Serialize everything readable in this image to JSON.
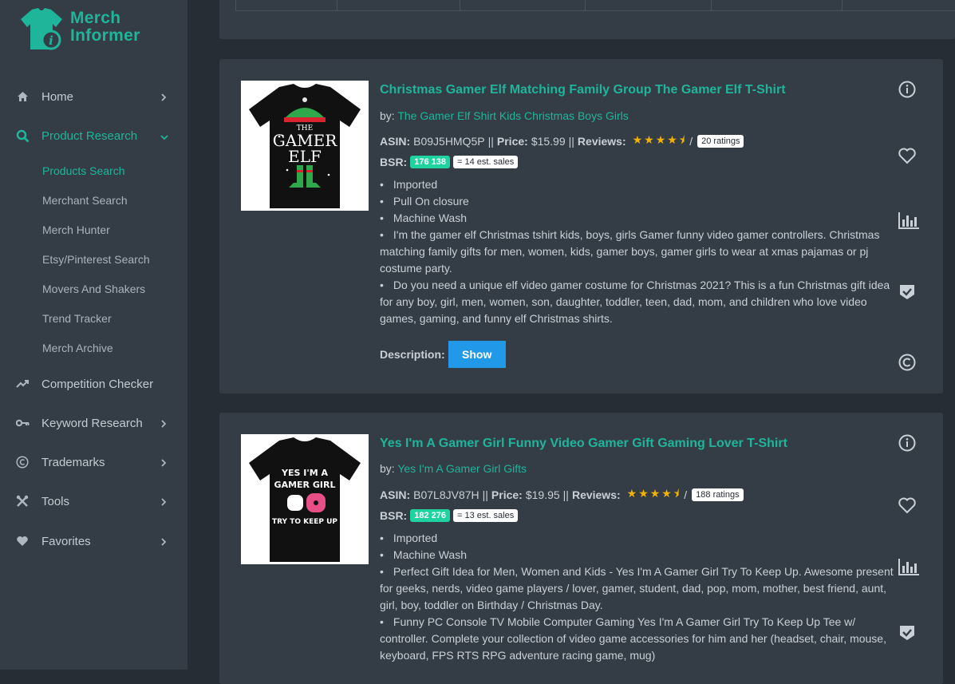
{
  "brand": {
    "line1": "Merch",
    "line2": "Informer",
    "color": "#1fb59b"
  },
  "sidebar": {
    "items": [
      {
        "label": "Home",
        "icon": "home-icon"
      },
      {
        "label": "Product Research",
        "icon": "search-icon",
        "active": true
      },
      {
        "label": "Competition Checker",
        "icon": "trend-icon"
      },
      {
        "label": "Keyword Research",
        "icon": "key-icon"
      },
      {
        "label": "Trademarks",
        "icon": "copyright-icon"
      },
      {
        "label": "Tools",
        "icon": "tools-icon"
      },
      {
        "label": "Favorites",
        "icon": "heart-icon"
      }
    ],
    "subitems": [
      "Products Search",
      "Merchant Search",
      "Merch Hunter",
      "Etsy/Pinterest Search",
      "Movers And Shakers",
      "Trend Tracker",
      "Merch Archive"
    ]
  },
  "products": [
    {
      "title": "Christmas Gamer Elf Matching Family Group The Gamer Elf T-Shirt",
      "by_label": "by:",
      "brand": "The Gamer Elf Shirt Kids Christmas Boys Girls",
      "asin_label": "ASIN:",
      "asin": "B09J5HMQ5P",
      "sep": "||",
      "price_label": "Price:",
      "price": "$15.99",
      "reviews_label": "Reviews:",
      "rating": 4.5,
      "stars": "★★★★⯨",
      "slash": "/",
      "ratings": "20 ratings",
      "bsr_label": "BSR:",
      "bsr": "176 138",
      "sales": "= 14 est. sales",
      "bullets": [
        "Imported",
        "Pull On closure",
        "Machine Wash",
        "I'm the gamer elf Christmas tshirt kids, boys, girls Gamer funny video gamer controllers. Christmas matching family gifts for men, women, kids, gamer boys, gamer girls to wear at xmas pajamas or pj costume party.",
        "Do you need a unique elf video gamer costume for Christmas 2021? This is a fun Christmas gift idea for any boy, girl, men, women, son, daughter, toddler, teen, dad, mom, and children who love video games, gaming, and funny elf Christmas shirts."
      ],
      "description_label": "Description:",
      "show_label": "Show",
      "shirt_text": [
        "THE",
        "GAMER",
        "ELF"
      ]
    },
    {
      "title": "Yes I'm A Gamer Girl Funny Video Gamer Gift Gaming Lover T-Shirt",
      "by_label": "by:",
      "brand": "Yes I'm A Gamer Girl Gifts",
      "asin_label": "ASIN:",
      "asin": "B07L8JV87H",
      "sep": "||",
      "price_label": "Price:",
      "price": "$19.95",
      "reviews_label": "Reviews:",
      "rating": 4.5,
      "stars": "★★★★⯨",
      "slash": "/",
      "ratings": "188 ratings",
      "bsr_label": "BSR:",
      "bsr": "182 276",
      "sales": "= 13 est. sales",
      "bullets": [
        "Imported",
        "Machine Wash",
        "Perfect Gift Idea for Men, Women and Kids - Yes I'm A Gamer Girl Try To Keep Up. Awesome present for geeks, nerds, video game players / lover, gamer, student, dad, pop, mom, mother, best friend, aunt, girl, boy, toddler on Birthday / Christmas Day.",
        "Funny PC Console TV Mobile Computer Gaming Yes I'm A Gamer Girl Try To Keep Up Tee w/ controller. Complete your collection of video game accessories for him and her (headset, chair, mouse, keyboard, FPS RTS RPG adventure racing game, mug)"
      ],
      "shirt_text": [
        "YES I'M A",
        "GAMER GIRL",
        "TRY TO KEEP UP"
      ]
    }
  ]
}
